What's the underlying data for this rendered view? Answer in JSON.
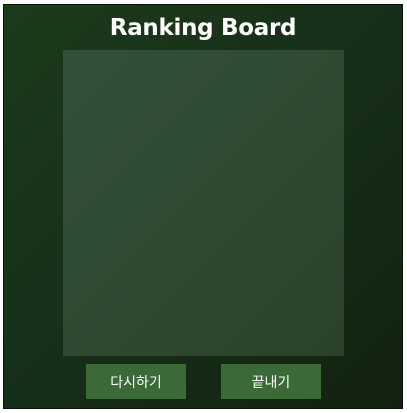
{
  "board": {
    "title": "Ranking Board"
  },
  "buttons": {
    "retry_label": "다시하기",
    "quit_label": "끝내기"
  },
  "colors": {
    "background_dark": "#17301a",
    "panel": "#2f4931",
    "button": "#3b6a38",
    "text": "#ffffff"
  }
}
